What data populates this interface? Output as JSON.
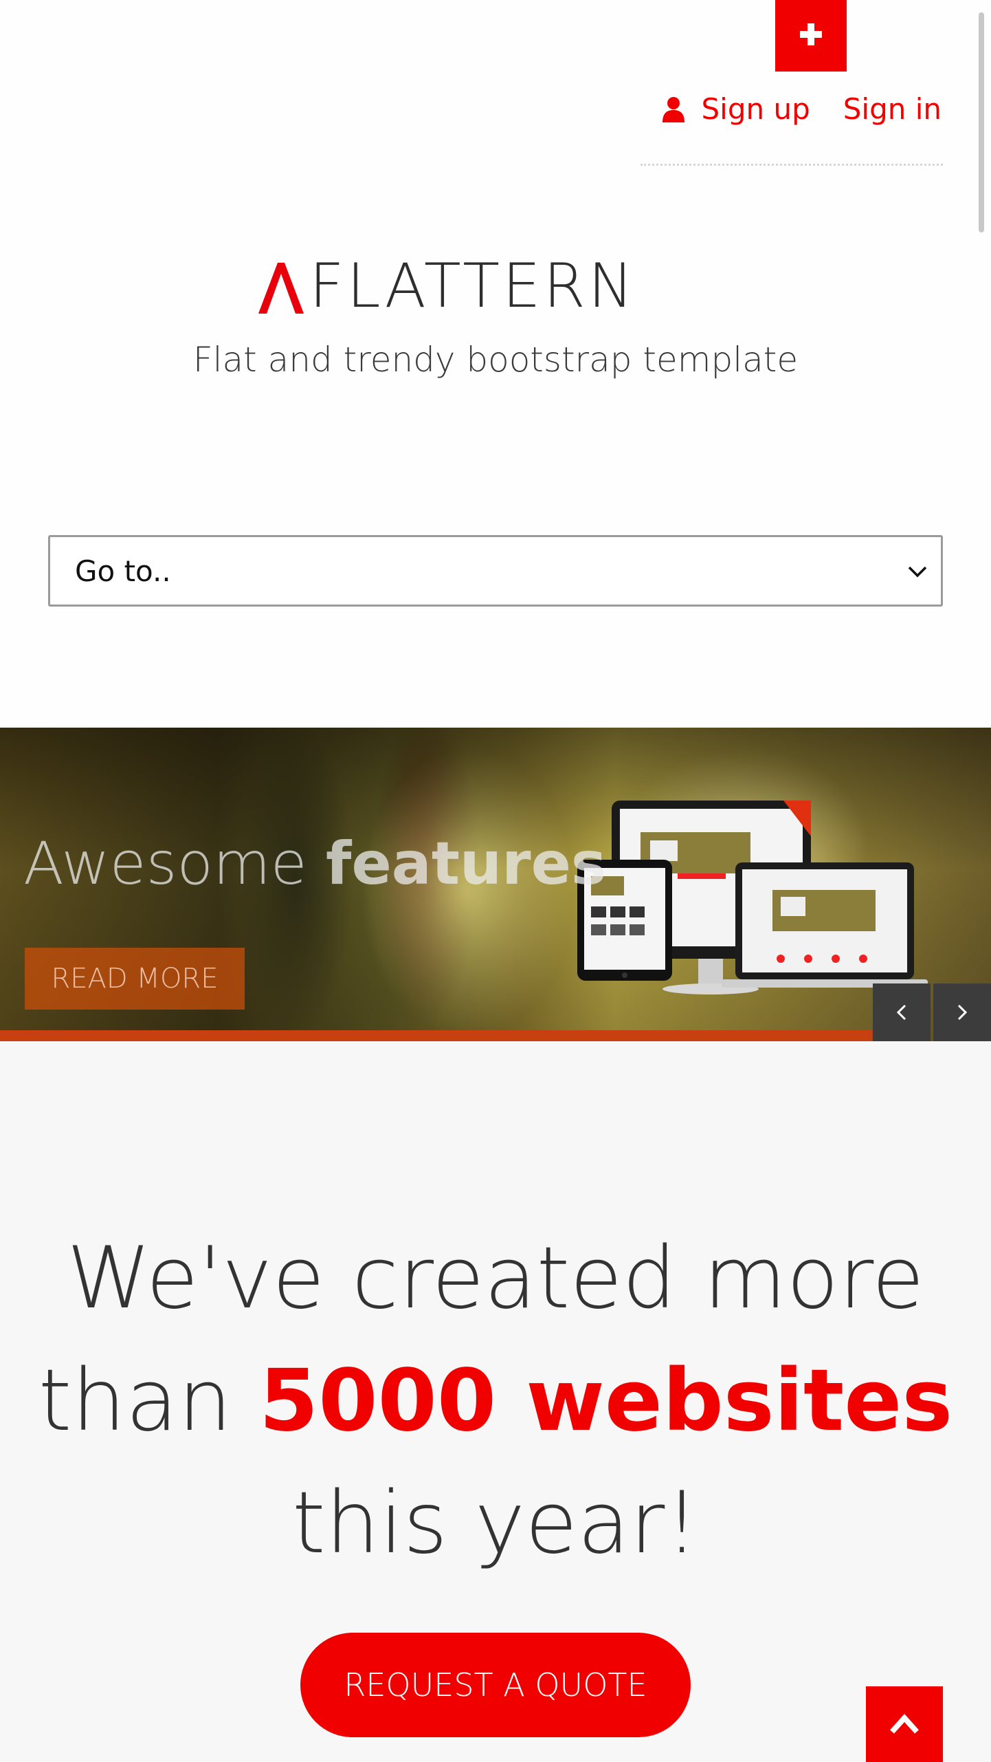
{
  "header": {
    "plus_icon": "plus-icon",
    "sign_up_label": "Sign up",
    "sign_in_label": "Sign in",
    "user_icon": "user-icon"
  },
  "brand": {
    "logo_text": "FLATTERN",
    "tagline": "Flat and trendy bootstrap template",
    "accent_color": "#f10000"
  },
  "nav": {
    "select_value": "Go to.."
  },
  "slider": {
    "title_light": "Awesome ",
    "title_bold": "features",
    "read_more_label": "READ MORE",
    "prev_icon": "chevron-left-icon",
    "next_icon": "chevron-right-icon",
    "progress_fraction": 0.88
  },
  "promo": {
    "line1": "We've created more",
    "line2_prefix": "than ",
    "line2_highlight": "5000 websites",
    "line3": "this year!",
    "quote_button_label": "REQUEST A QUOTE"
  },
  "scroll_top": {
    "icon": "chevron-up-icon"
  }
}
